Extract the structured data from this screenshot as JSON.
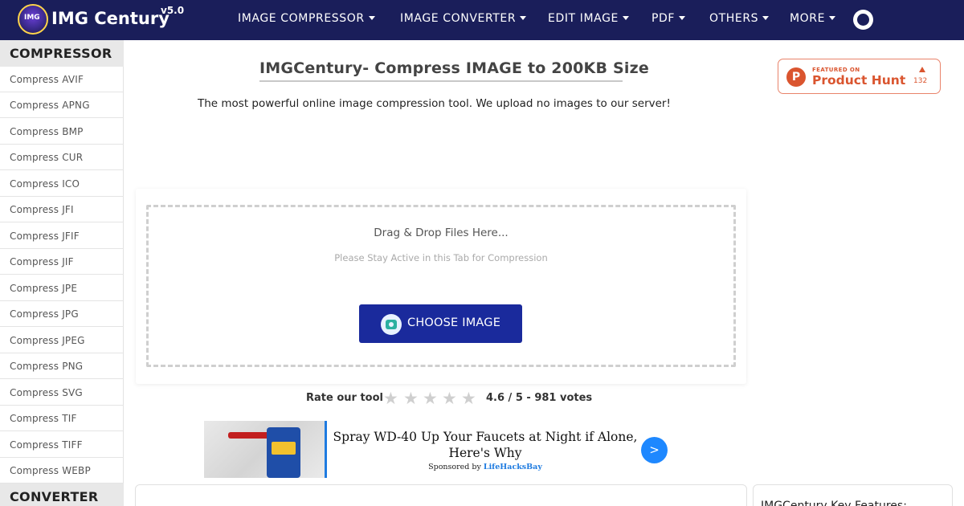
{
  "header": {
    "brand": "IMG Century",
    "version": "v5.0",
    "logo_text": "IMG",
    "nav": [
      {
        "label": "IMAGE COMPRESSOR",
        "has_dropdown": true
      },
      {
        "label": "IMAGE CONVERTER",
        "has_dropdown": true
      },
      {
        "label": "EDIT IMAGE",
        "has_dropdown": true
      },
      {
        "label": "PDF",
        "has_dropdown": true
      },
      {
        "label": "OTHERS",
        "has_dropdown": true
      },
      {
        "label": "MORE",
        "has_dropdown": true
      }
    ],
    "theme_toggle_icon": "dark-mode-toggle-icon"
  },
  "sidebar": {
    "compressor_heading": "COMPRESSOR",
    "items": [
      {
        "label": "Compress AVIF"
      },
      {
        "label": "Compress APNG"
      },
      {
        "label": "Compress BMP"
      },
      {
        "label": "Compress CUR"
      },
      {
        "label": "Compress ICO"
      },
      {
        "label": "Compress JFI"
      },
      {
        "label": "Compress JFIF"
      },
      {
        "label": "Compress JIF"
      },
      {
        "label": "Compress JPE"
      },
      {
        "label": "Compress JPG"
      },
      {
        "label": "Compress JPEG"
      },
      {
        "label": "Compress PNG"
      },
      {
        "label": "Compress SVG"
      },
      {
        "label": "Compress TIF"
      },
      {
        "label": "Compress TIFF"
      },
      {
        "label": "Compress WEBP"
      }
    ],
    "converter_heading": "CONVERTER"
  },
  "main": {
    "title": "IMGCentury- Compress IMAGE to 200KB Size",
    "subtitle": "The most powerful online image compression tool. We upload no images to our server!",
    "upload": {
      "drop_text": "Drag & Drop Files Here...",
      "hint": "Please Stay Active in this Tab for Compression",
      "button_label": "CHOOSE IMAGE",
      "button_icon": "camera-icon"
    },
    "rating": {
      "label": "Rate our tool",
      "stars_total": 5,
      "stars_filled": 0,
      "score_text": "4.6 / 5 - 981 votes"
    }
  },
  "product_hunt": {
    "featured_on": "FEATURED ON",
    "name": "Product Hunt",
    "logo_letter": "P",
    "upvotes": "132",
    "color": "#da552f"
  },
  "ad": {
    "title": "Spray WD-40 Up Your Faucets at Night if Alone, Here's Why",
    "sponsor_prefix": "Sponsored by",
    "sponsor_name": "LifeHacksBay",
    "go_label": ">"
  },
  "features_panel": {
    "title": "IMGCentury  Key Features:"
  },
  "colors": {
    "navbar": "#1a1e5a",
    "primary_button": "#1a2a9c",
    "ad_accent": "#1e88ff"
  }
}
